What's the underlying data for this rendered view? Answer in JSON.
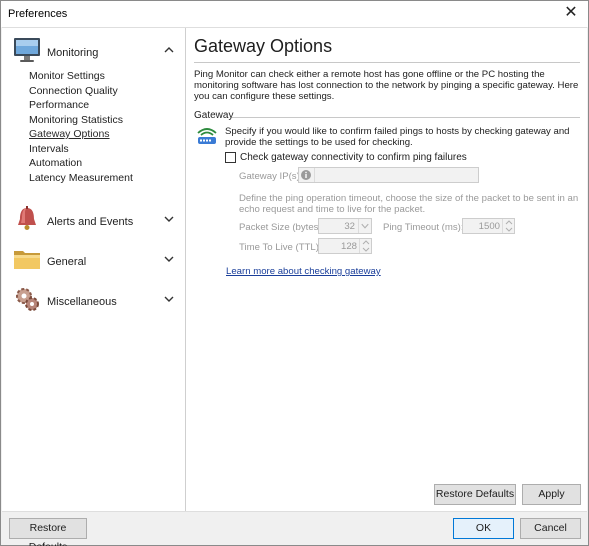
{
  "window": {
    "title": "Preferences",
    "close_glyph": "✕"
  },
  "sidebar": {
    "groups": [
      {
        "label": "Monitoring",
        "icon": "monitor-icon",
        "expanded": true,
        "items": [
          {
            "label": "Monitor Settings"
          },
          {
            "label": "Connection Quality"
          },
          {
            "label": "Performance"
          },
          {
            "label": "Monitoring Statistics"
          },
          {
            "label": "Gateway Options",
            "active": true
          },
          {
            "label": "Intervals"
          },
          {
            "label": "Automation"
          },
          {
            "label": "Latency Measurement"
          }
        ]
      },
      {
        "label": "Alerts and Events",
        "icon": "bell-icon",
        "expanded": false
      },
      {
        "label": "General",
        "icon": "folder-icon",
        "expanded": false
      },
      {
        "label": "Miscellaneous",
        "icon": "gears-icon",
        "expanded": false
      }
    ]
  },
  "content": {
    "title": "Gateway Options",
    "intro": "Ping Monitor can check either a remote host has gone offline or the PC hosting the monitoring software has lost connection to the network by pinging a specific gateway. Here you can configure these settings.",
    "section_label": "Gateway",
    "gateway_description": "Specify if you would like to confirm failed pings to hosts by checking gateway and provide the settings to be used for checking.",
    "check_gateway": {
      "label": "Check gateway connectivity to confirm ping failures",
      "checked": false
    },
    "gateway_ip": {
      "label": "Gateway IP(s):",
      "value": ""
    },
    "timeout_description": "Define the ping operation timeout, choose the size of the packet to be sent in an echo request and time to live for the packet.",
    "packet_size": {
      "label": "Packet Size (bytes):",
      "value": "32"
    },
    "ping_timeout": {
      "label": "Ping Timeout (ms):",
      "value": "1500"
    },
    "ttl": {
      "label": "Time To Live (TTL):",
      "value": "128"
    },
    "learn_more": "Learn more about checking gateway",
    "restore_defaults_label": "Restore Defaults",
    "apply_label": "Apply"
  },
  "footer": {
    "restore_defaults_label": "Restore Defaults",
    "ok_label": "OK",
    "cancel_label": "Cancel"
  },
  "colors": {
    "link": "#1a3e9a",
    "disabled_text": "#9a9a9a",
    "primary_border": "#0078d7"
  }
}
